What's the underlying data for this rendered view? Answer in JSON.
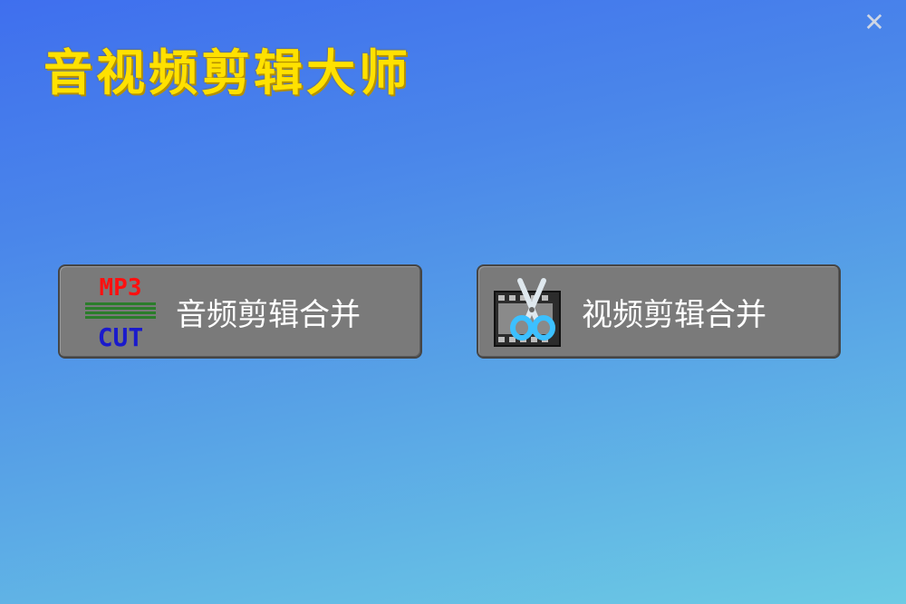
{
  "window": {
    "title": "音视频剪辑大师",
    "close_glyph": "✕"
  },
  "buttons": {
    "audio": {
      "label": "音频剪辑合并",
      "icon": "mp3-cut-icon",
      "icon_text_top": "MP3",
      "icon_text_bottom": "CUT"
    },
    "video": {
      "label": "视频剪辑合并",
      "icon": "film-scissors-icon"
    }
  },
  "colors": {
    "title": "#ffe100",
    "button_bg": "#7a7a7a",
    "background_top": "#3f6fee",
    "background_bottom": "#6ccbe4"
  }
}
